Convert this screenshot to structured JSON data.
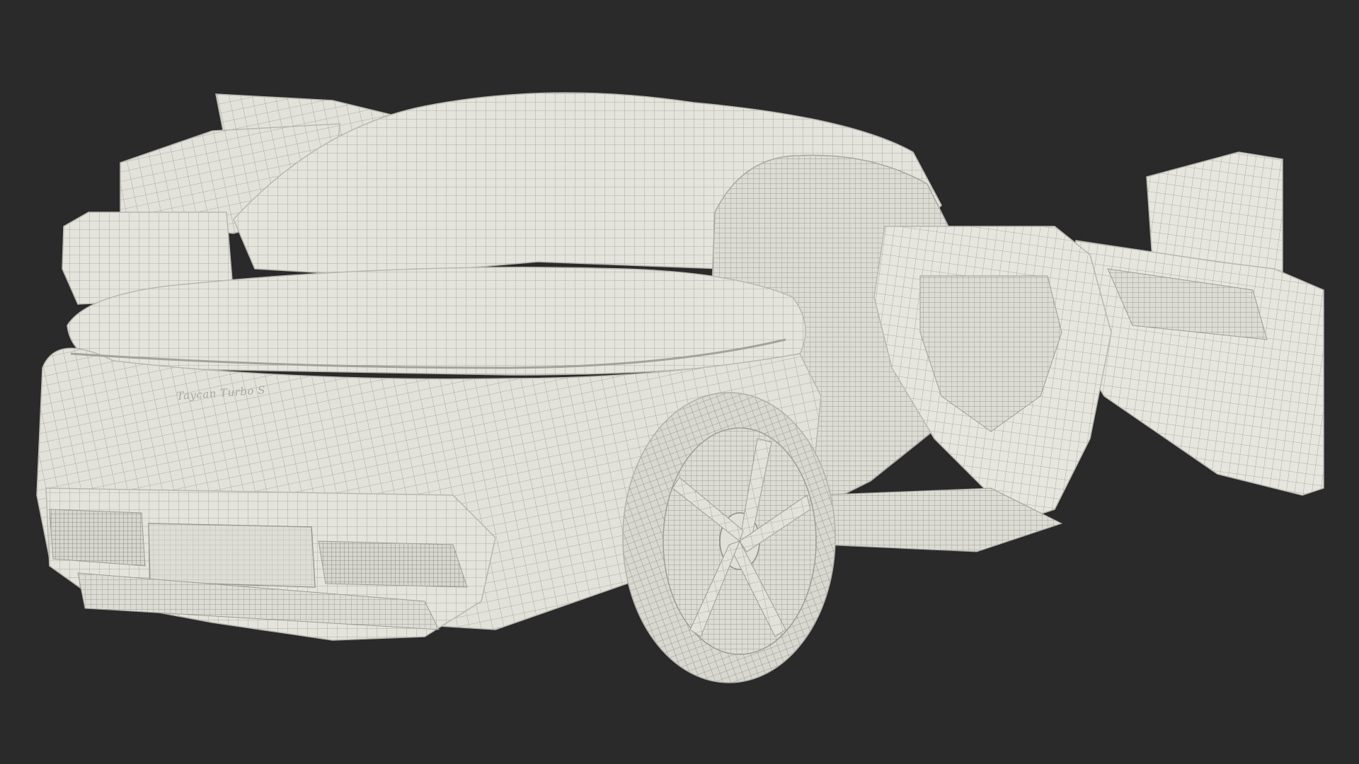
{
  "scene": {
    "background_color": "#2a2a2a",
    "surface_color": "#e4e4dc",
    "wire_color": "#9c9c96",
    "shadow_color": "#c7c7c0",
    "badge_text": "Taycan Turbo S"
  }
}
